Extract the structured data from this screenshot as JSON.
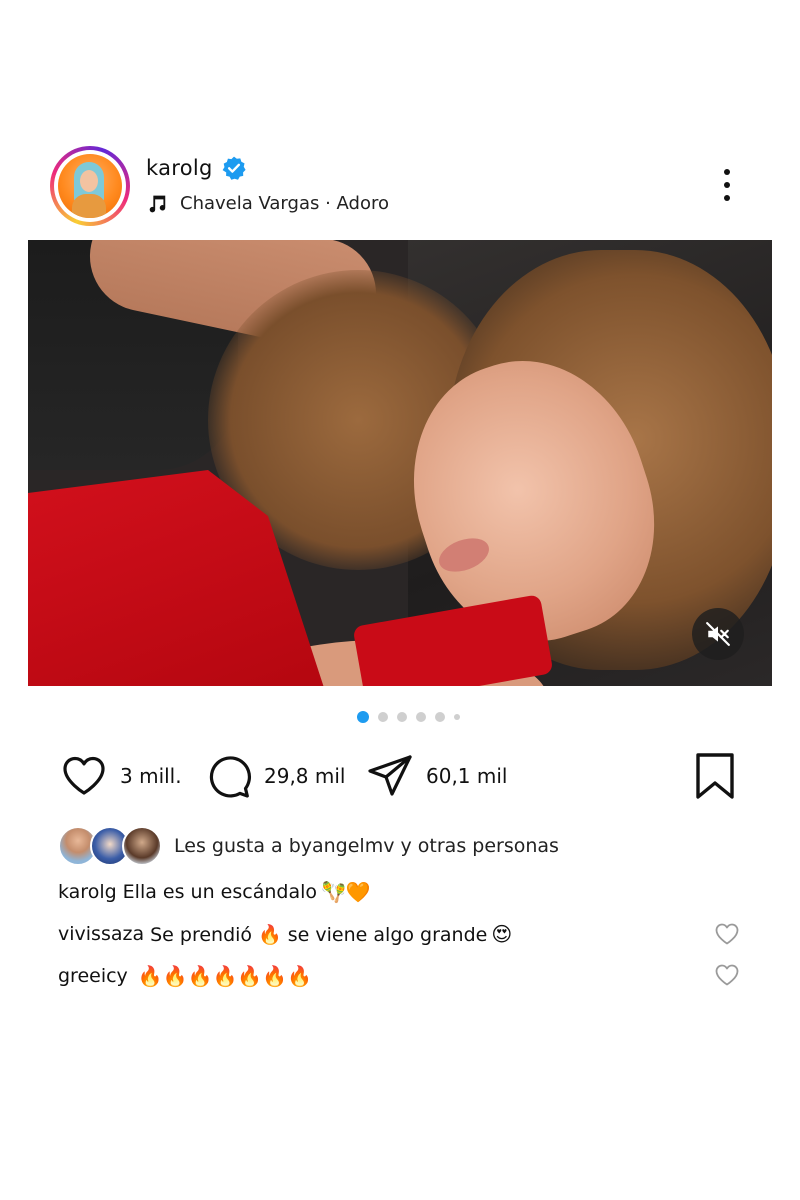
{
  "post": {
    "username": "karolg",
    "music": "Chavela Vargas · Adoro"
  },
  "actions": {
    "likes": "3 mill.",
    "comments": "29,8 mil",
    "shares": "60,1 mil"
  },
  "carousel": {
    "total_dots": 6,
    "active_index": 0
  },
  "liked_by": {
    "text": "Les gusta a byangelmv y otras personas"
  },
  "comments": [
    {
      "user": "karolg",
      "text": "Ella es un escándalo",
      "emoji": "🪇🧡"
    },
    {
      "user": "vivissaza",
      "text": "Se prendió 🔥 se viene algo grande",
      "emoji": "😍"
    },
    {
      "user": "greeicy",
      "text": "",
      "emoji": "🔥🔥🔥🔥🔥🔥🔥"
    }
  ],
  "colors": {
    "verified": "#1d9bf0",
    "active_dot": "#1d9bf0"
  },
  "icons": [
    "verified-badge-icon",
    "music-note-icon",
    "more-vertical-icon",
    "mute-icon",
    "heart-icon",
    "comment-icon",
    "share-icon",
    "bookmark-icon"
  ]
}
